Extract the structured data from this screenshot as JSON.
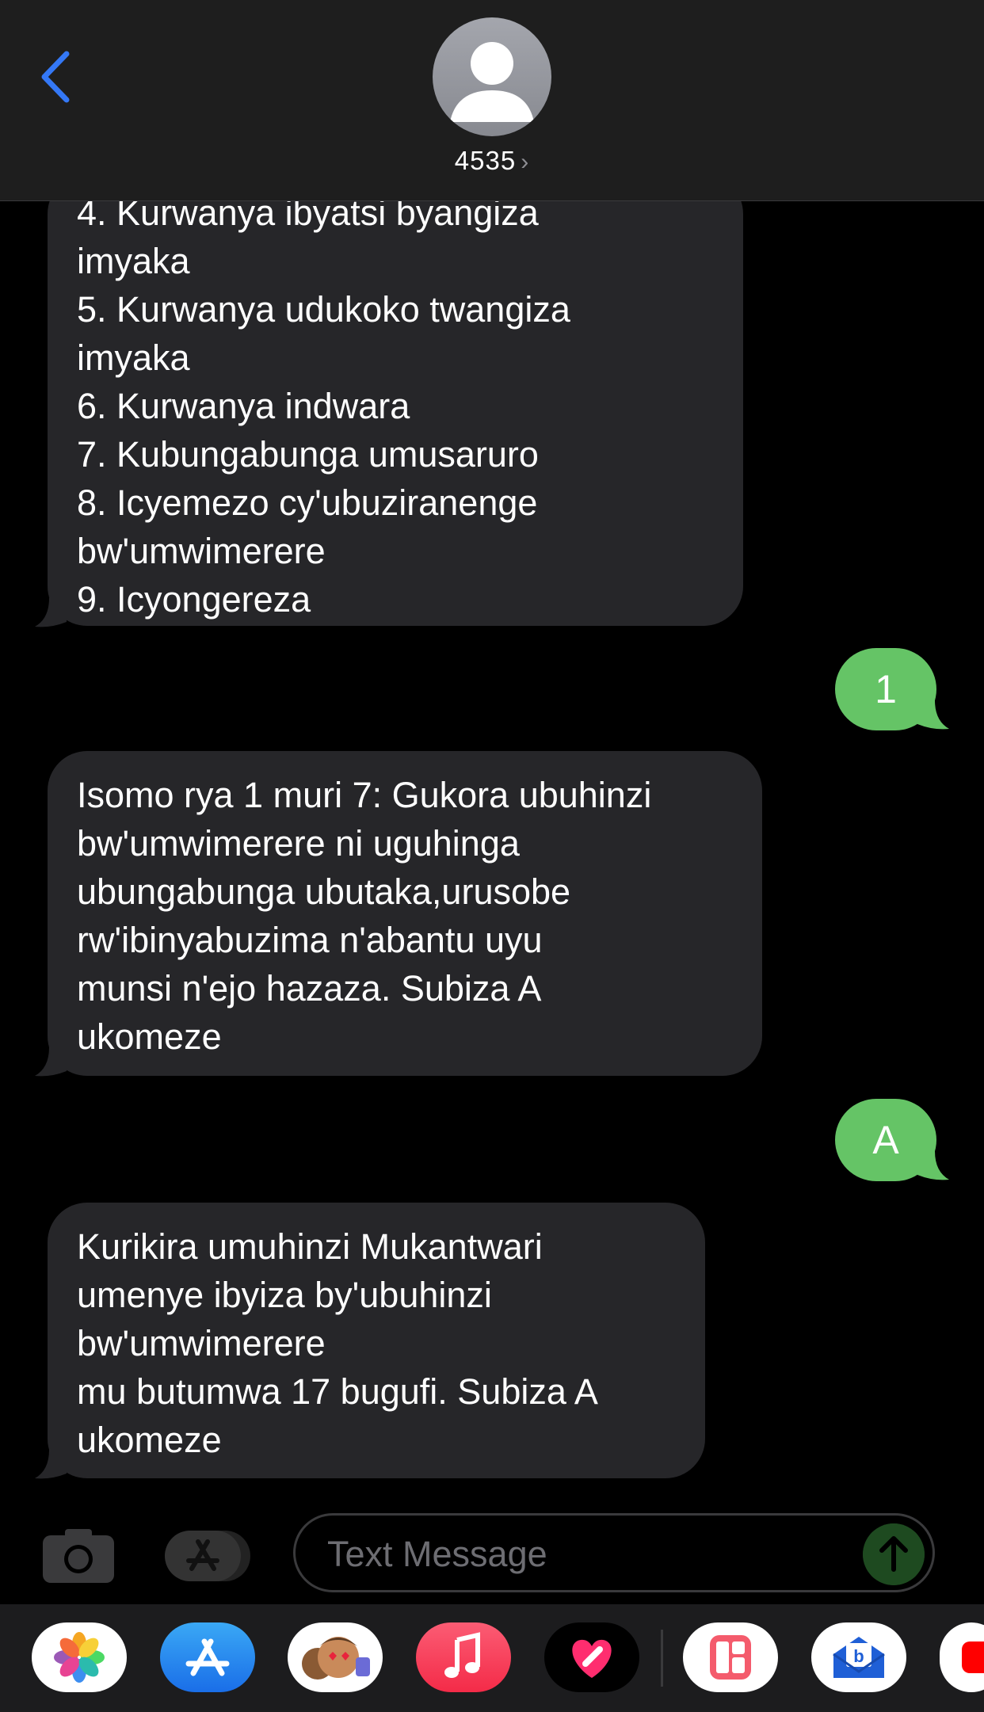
{
  "header": {
    "contact_name": "4535",
    "chevron": "›",
    "back_icon": "chevron-left-icon",
    "avatar_icon": "person-icon"
  },
  "messages": {
    "msg1": "4. Kurwanya ibyatsi byangiza\nimyaka\n5. Kurwanya udukoko twangiza\nimyaka\n6. Kurwanya indwara\n7. Kubungabunga umusaruro\n8. Icyemezo cy'ubuziranenge\nbw'umwimerere\n9. Icyongereza",
    "out1": "1",
    "msg2": "Isomo rya 1 muri 7: Gukora ubuhinzi\nbw'umwimerere ni uguhinga\nubungabunga ubutaka,urusobe\nrw'ibinyabuzima n'abantu uyu\nmunsi n'ejo hazaza.  Subiza A\nukomeze",
    "out2": "A",
    "msg3": "Kurikira umuhinzi Mukantwari\numenye ibyiza by'ubuhinzi\nbw'umwimerere\nmu butumwa 17 bugufi. Subiza A\nukomeze"
  },
  "input": {
    "placeholder": "Text Message",
    "camera_icon": "camera-icon",
    "apps_icon": "app-store-icon",
    "send_icon": "send-arrow-icon"
  },
  "app_strip": [
    "photos-icon",
    "app-store-icon",
    "memoji-icon",
    "music-icon",
    "fitness-heart-icon",
    "widget-app-icon",
    "mail-app-icon",
    "partial-app-icon"
  ],
  "colors": {
    "incoming": "#262629",
    "outgoing": "#65c466",
    "accent": "#3478f6"
  }
}
